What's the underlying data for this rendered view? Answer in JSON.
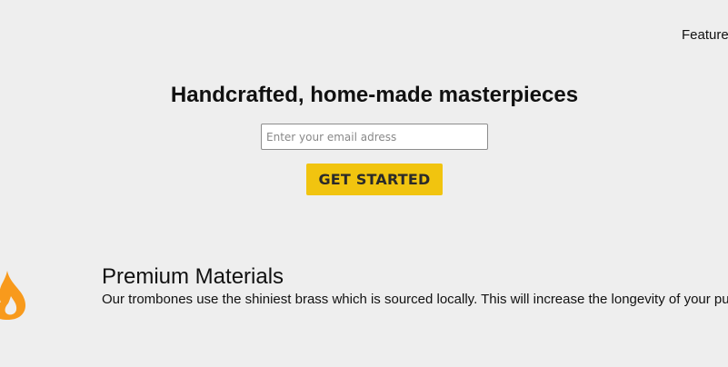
{
  "header": {
    "nav_links": [
      {
        "label": "Features"
      }
    ]
  },
  "hero": {
    "title": "Handcrafted, home-made masterpieces",
    "email_placeholder": "Enter your email adress",
    "cta_label": "GET STARTED"
  },
  "features": [
    {
      "icon": "fire-icon",
      "title": "Premium Materials",
      "description": "Our trombones use the shiniest brass which is sourced locally. This will increase the longevity of your purchase."
    }
  ],
  "colors": {
    "background": "#eeeeee",
    "accent": "#f1c40f",
    "icon_orange": "#f89a1c"
  }
}
